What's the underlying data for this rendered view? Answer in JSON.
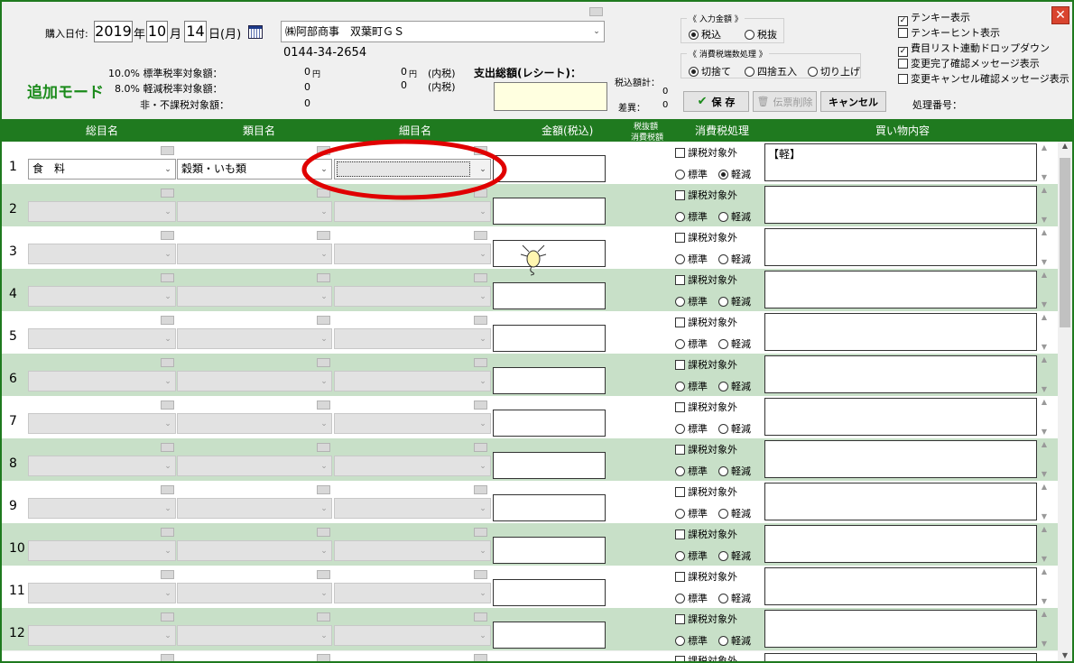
{
  "header": {
    "purchase_date_label": "購入日付:",
    "year": "2019",
    "year_unit": "年",
    "month": "10",
    "month_unit": "月",
    "day": "14",
    "day_unit": "日",
    "weekday": "(月)",
    "calendar_icon": "calendar-icon",
    "store_name": "㈱阿部商事　双葉町ＧＳ",
    "store_phone": "0144-34-2654",
    "mode_label": "追加モード",
    "tax_rows": [
      {
        "label": "10.0% 標準税率対象額：",
        "amount": "0",
        "unit": "円",
        "incl_amount": "0",
        "incl_unit": "円",
        "incl_note": "(内税)"
      },
      {
        "label": "8.0% 軽減税率対象額：",
        "amount": "0",
        "unit": "",
        "incl_amount": "0",
        "incl_unit": "",
        "incl_note": "(内税)"
      },
      {
        "label": "非・不課税対象額：",
        "amount": "0",
        "unit": "",
        "incl_amount": "",
        "incl_unit": "",
        "incl_note": ""
      }
    ],
    "total_label": "支出総額(レシート)：",
    "total_value": "",
    "taxin_sum_label": "税込額計：",
    "taxin_sum_value": "0",
    "diff_label": "差異：",
    "diff_value": "0"
  },
  "input_amount_group": {
    "title": "《 入力金額 》",
    "options": [
      "税込",
      "税抜"
    ],
    "selected": 0
  },
  "rounding_group": {
    "title": "《 消費税端数処理 》",
    "options": [
      "切捨て",
      "四捨五入",
      "切り上げ"
    ],
    "selected": 0
  },
  "buttons": {
    "save": "保 存",
    "delete": "伝票削除",
    "cancel": "キャンセル"
  },
  "processing_number_label": "処理番号：",
  "options_panel": [
    {
      "label": "テンキー表示",
      "checked": true
    },
    {
      "label": "テンキーヒント表示",
      "checked": false
    },
    {
      "label": "費目リスト連動ドロップダウン",
      "checked": true
    },
    {
      "label": "変更完了確認メッセージ表示",
      "checked": false
    },
    {
      "label": "変更キャンセル確認メッセージ表示",
      "checked": false
    }
  ],
  "columns": {
    "category": "総目名",
    "subcategory": "類目名",
    "item": "細目名",
    "amount": "金額(税込)",
    "tax_amount_top": "税抜額",
    "tax_amount_bottom": "消費税額",
    "tax_processing": "消費税処理",
    "memo": "買い物内容"
  },
  "tax_exempt_label": "課税対象外",
  "tax_standard_label": "標準",
  "tax_reduced_label": "軽減",
  "rows": [
    {
      "num": "1",
      "category": "食　料",
      "subcategory": "穀類・いも類",
      "item": "",
      "amount": "",
      "memo": "【軽】",
      "tax": "reduced",
      "active": true
    },
    {
      "num": "2",
      "category": "",
      "subcategory": "",
      "item": "",
      "amount": "",
      "memo": "",
      "tax": "",
      "active": false
    },
    {
      "num": "3",
      "category": "",
      "subcategory": "",
      "item": "",
      "amount": "",
      "memo": "",
      "tax": "",
      "active": false
    },
    {
      "num": "4",
      "category": "",
      "subcategory": "",
      "item": "",
      "amount": "",
      "memo": "",
      "tax": "",
      "active": false
    },
    {
      "num": "5",
      "category": "",
      "subcategory": "",
      "item": "",
      "amount": "",
      "memo": "",
      "tax": "",
      "active": false
    },
    {
      "num": "6",
      "category": "",
      "subcategory": "",
      "item": "",
      "amount": "",
      "memo": "",
      "tax": "",
      "active": false
    },
    {
      "num": "7",
      "category": "",
      "subcategory": "",
      "item": "",
      "amount": "",
      "memo": "",
      "tax": "",
      "active": false
    },
    {
      "num": "8",
      "category": "",
      "subcategory": "",
      "item": "",
      "amount": "",
      "memo": "",
      "tax": "",
      "active": false
    },
    {
      "num": "9",
      "category": "",
      "subcategory": "",
      "item": "",
      "amount": "",
      "memo": "",
      "tax": "",
      "active": false
    },
    {
      "num": "10",
      "category": "",
      "subcategory": "",
      "item": "",
      "amount": "",
      "memo": "",
      "tax": "",
      "active": false
    },
    {
      "num": "11",
      "category": "",
      "subcategory": "",
      "item": "",
      "amount": "",
      "memo": "",
      "tax": "",
      "active": false
    },
    {
      "num": "12",
      "category": "",
      "subcategory": "",
      "item": "",
      "amount": "",
      "memo": "",
      "tax": "",
      "active": false
    }
  ],
  "colors": {
    "accent_green": "#1f7a1f",
    "mode_green": "#1a8a1a",
    "row_alt": "#c8e0c8",
    "highlight_red": "#e00000",
    "total_bg": "#ffffe0",
    "close_red": "#d9442f"
  }
}
